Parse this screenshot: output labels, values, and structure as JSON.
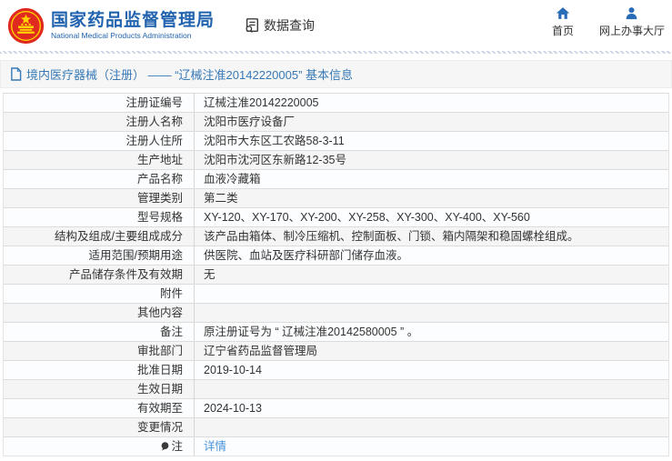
{
  "header": {
    "org_name_zh": "国家药品监督管理局",
    "org_name_en": "National Medical Products Administration",
    "data_query_label": "数据查询",
    "home_label": "首页",
    "service_hall_label": "网上办事大厅"
  },
  "title_bar": {
    "title": "境内医疗器械（注册） —— “辽械注准20142220005” 基本信息"
  },
  "table": {
    "rows": [
      {
        "label": "注册证编号",
        "value": "辽械注准20142220005"
      },
      {
        "label": "注册人名称",
        "value": "沈阳市医疗设备厂"
      },
      {
        "label": "注册人住所",
        "value": "沈阳市大东区工农路58-3-11"
      },
      {
        "label": "生产地址",
        "value": "沈阳市沈河区东新路12-35号"
      },
      {
        "label": "产品名称",
        "value": "血液冷藏箱"
      },
      {
        "label": "管理类别",
        "value": "第二类"
      },
      {
        "label": "型号规格",
        "value": "XY-120、XY-170、XY-200、XY-258、XY-300、XY-400、XY-560"
      },
      {
        "label": "结构及组成/主要组成成分",
        "value": "该产品由箱体、制冷压缩机、控制面板、门锁、箱内隔架和稳固螺栓组成。"
      },
      {
        "label": "适用范围/预期用途",
        "value": "供医院、血站及医疗科研部门储存血液。"
      },
      {
        "label": "产品储存条件及有效期",
        "value": "无"
      },
      {
        "label": "附件",
        "value": ""
      },
      {
        "label": "其他内容",
        "value": ""
      },
      {
        "label": "备注",
        "value": "原注册证号为 “ 辽械注准20142580005 ” 。"
      },
      {
        "label": "审批部门",
        "value": "辽宁省药品监督管理局"
      },
      {
        "label": "批准日期",
        "value": "2019-10-14"
      },
      {
        "label": "生效日期",
        "value": ""
      },
      {
        "label": "有效期至",
        "value": "2024-10-13"
      },
      {
        "label": "变更情况",
        "value": ""
      },
      {
        "label": "注",
        "value": "详情"
      }
    ]
  },
  "icons": {
    "logo": "national-emblem",
    "data_query": "doc-search-icon",
    "home": "home-icon",
    "service_hall": "person-icon",
    "title": "document-icon",
    "note": "comment-icon"
  },
  "colors": {
    "brand_blue": "#2163ae",
    "title_blue": "#3779b6",
    "link_blue": "#4593db",
    "emblem_red": "#e02a1f",
    "emblem_gold": "#ffd100",
    "border_gray": "#dcdcdc",
    "row_alt_gray": "#f5f5f5",
    "text_dark": "#333333"
  }
}
